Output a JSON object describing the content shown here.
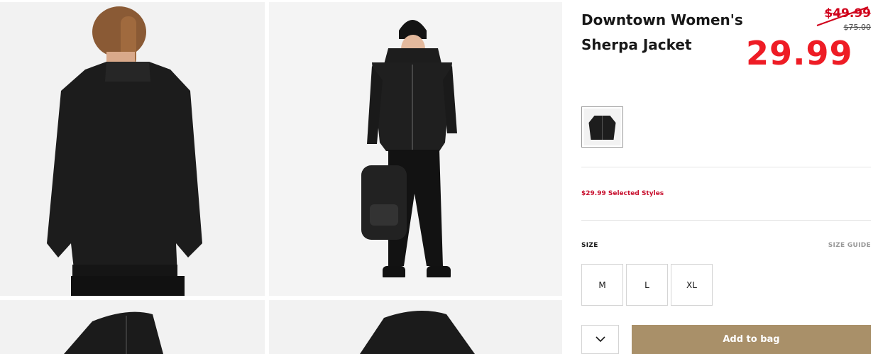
{
  "product": {
    "title": "Downtown Women's Sherpa Jacket",
    "price_original": "$49.99",
    "price_was": "$75.00",
    "price_sale": "29.99",
    "promo_text": "$29.99 Selected Styles"
  },
  "colors": {
    "accent_red": "#ee1c25",
    "promo_red": "#c8102e",
    "button_bg": "#a99069"
  },
  "size_section": {
    "label": "SIZE",
    "guide_label": "SIZE GUIDE",
    "options": [
      "M",
      "L",
      "XL"
    ]
  },
  "quantity": {
    "icon": "chevron-down-icon"
  },
  "actions": {
    "add_to_bag": "Add to bag"
  }
}
